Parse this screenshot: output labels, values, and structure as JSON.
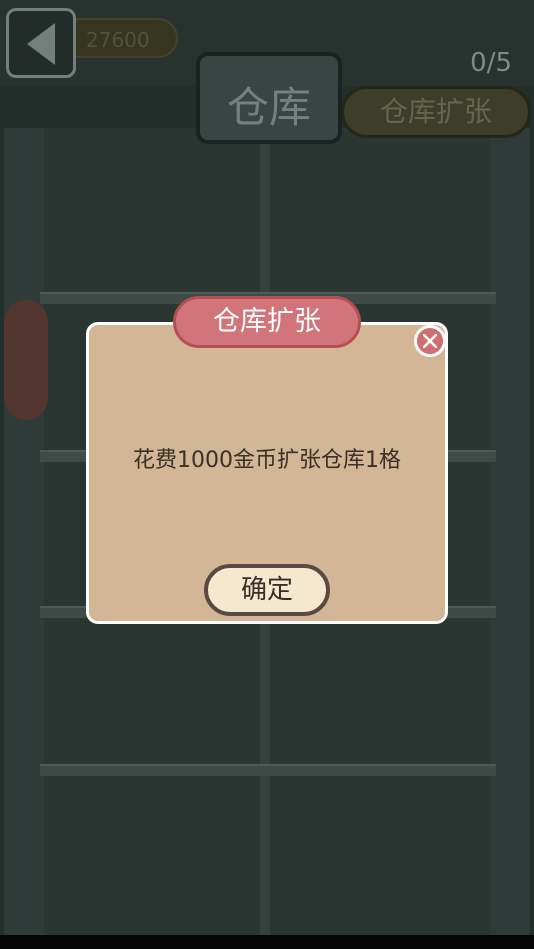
{
  "top_bar": {
    "back_icon": "back-arrow-icon",
    "coins": "27600",
    "count": "0/5"
  },
  "warehouse": {
    "title": "仓库",
    "expand_button": "仓库扩张"
  },
  "dialog": {
    "header": "仓库扩张",
    "close_icon": "close-icon",
    "message": "花费1000金币扩张仓库1格",
    "confirm_button": "确定"
  },
  "colors": {
    "dialog_bg": "#d2b696",
    "header_bg": "#d2757a",
    "confirm_bg": "#f6e8cf"
  }
}
